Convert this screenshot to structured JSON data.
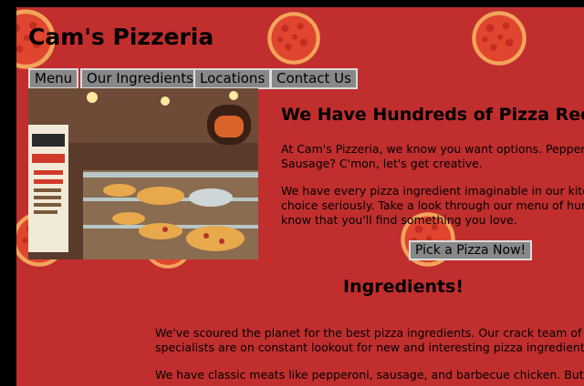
{
  "site": {
    "title": "Cam's Pizzeria"
  },
  "nav": {
    "items": [
      {
        "label": "Menu"
      },
      {
        "label": "Our Ingredients"
      },
      {
        "label": "Locations"
      },
      {
        "label": "Contact Us"
      }
    ]
  },
  "hero": {
    "heading": "We Have Hundreds of Pizza Recipes",
    "paragraph1_line1": "At Cam's Pizzeria, we know you want options. Pepperoni?",
    "paragraph1_line2": "Sausage? C'mon, let's get creative.",
    "paragraph2_line1": "We have every pizza ingredient imaginable in our kitchen, so we take",
    "paragraph2_line2": "choice seriously. Take a look through our menu of hundreds of pizzas and",
    "paragraph2_line3": "know that you'll find something you love.",
    "cta_label": "Pick a Pizza Now!",
    "photo": {
      "banner_lines": [
        "Paisano",
        "Pizzeria",
        "NOW HIRING",
        "PIZZA MAKERS",
        "TRAINEES",
        "CASHIERS",
        "KITCHEN HELPERS"
      ]
    }
  },
  "ingredients": {
    "heading": "Ingredients!",
    "paragraph1_line1": "We've scoured the planet for the best pizza ingredients. Our crack team of ingredient",
    "paragraph1_line2": "specialists are on constant lookout for new and interesting pizza ingredients to add.",
    "paragraph2_line1": "We have classic meats like pepperoni, sausage, and barbecue chicken. But you'll also"
  },
  "colors": {
    "page_background": "#c12e2e",
    "button_background": "#888888",
    "button_border": "#dcdcdc",
    "text": "#000000"
  },
  "icons": {
    "background_decoration": "pizza-icon"
  }
}
